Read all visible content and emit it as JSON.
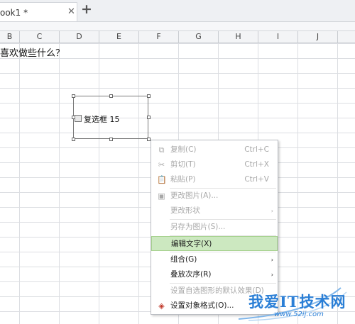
{
  "tab": {
    "title": "ook1 *",
    "close_glyph": "✕",
    "add_glyph": "+"
  },
  "columns": [
    "B",
    "C",
    "D",
    "E",
    "F",
    "G",
    "H",
    "I",
    "J"
  ],
  "cell_text": "喜欢做些什么？",
  "checkbox": {
    "label": "复选框 15"
  },
  "context_menu": {
    "items": [
      {
        "label": "复制(C)",
        "shortcut": "Ctrl+C",
        "icon": "copy-icon",
        "glyph": "⧉",
        "enabled": false
      },
      {
        "label": "剪切(T)",
        "shortcut": "Ctrl+X",
        "icon": "scissors-icon",
        "glyph": "✂",
        "enabled": false
      },
      {
        "label": "粘贴(P)",
        "shortcut": "Ctrl+V",
        "icon": "paste-icon",
        "glyph": "📋",
        "enabled": false
      },
      {
        "label": "更改图片(A)...",
        "icon": "change-picture-icon",
        "glyph": "▣",
        "enabled": false
      },
      {
        "label": "更改形状",
        "submenu": true,
        "enabled": false
      },
      {
        "label": "另存为图片(S)...",
        "enabled": false
      },
      {
        "label": "编辑文字(X)",
        "enabled": true,
        "highlighted": true
      },
      {
        "label": "组合(G)",
        "submenu": true,
        "enabled": true
      },
      {
        "label": "叠放次序(R)",
        "submenu": true,
        "enabled": true
      },
      {
        "label": "设置自选图形的默认效果(D)",
        "enabled": false
      },
      {
        "label": "设置对象格式(O)...",
        "icon": "format-object-icon",
        "glyph": "◈",
        "enabled": true
      }
    ],
    "submenu_arrow": "›"
  },
  "watermark": {
    "title": "我爱IT技术网",
    "url": "www.52ij.com"
  },
  "colors": {
    "highlight_bg": "#cce8c0",
    "watermark_blue": "#2b7fd6",
    "disabled_text": "#a8a8a8"
  }
}
